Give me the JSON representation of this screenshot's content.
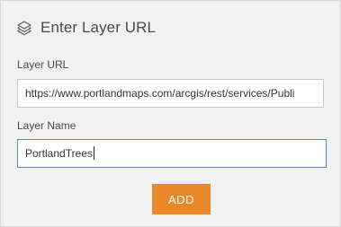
{
  "header": {
    "icon": "layers-icon",
    "title": "Enter Layer URL"
  },
  "form": {
    "url_label": "Layer URL",
    "url_value": "https://www.portlandmaps.com/arcgis/rest/services/Publi",
    "name_label": "Layer Name",
    "name_value": "PortlandTrees",
    "add_label": "ADD"
  },
  "colors": {
    "panel_bg": "#f1f1f1",
    "accent_button": "#e8882a",
    "focus_border": "#5a8ebf"
  }
}
